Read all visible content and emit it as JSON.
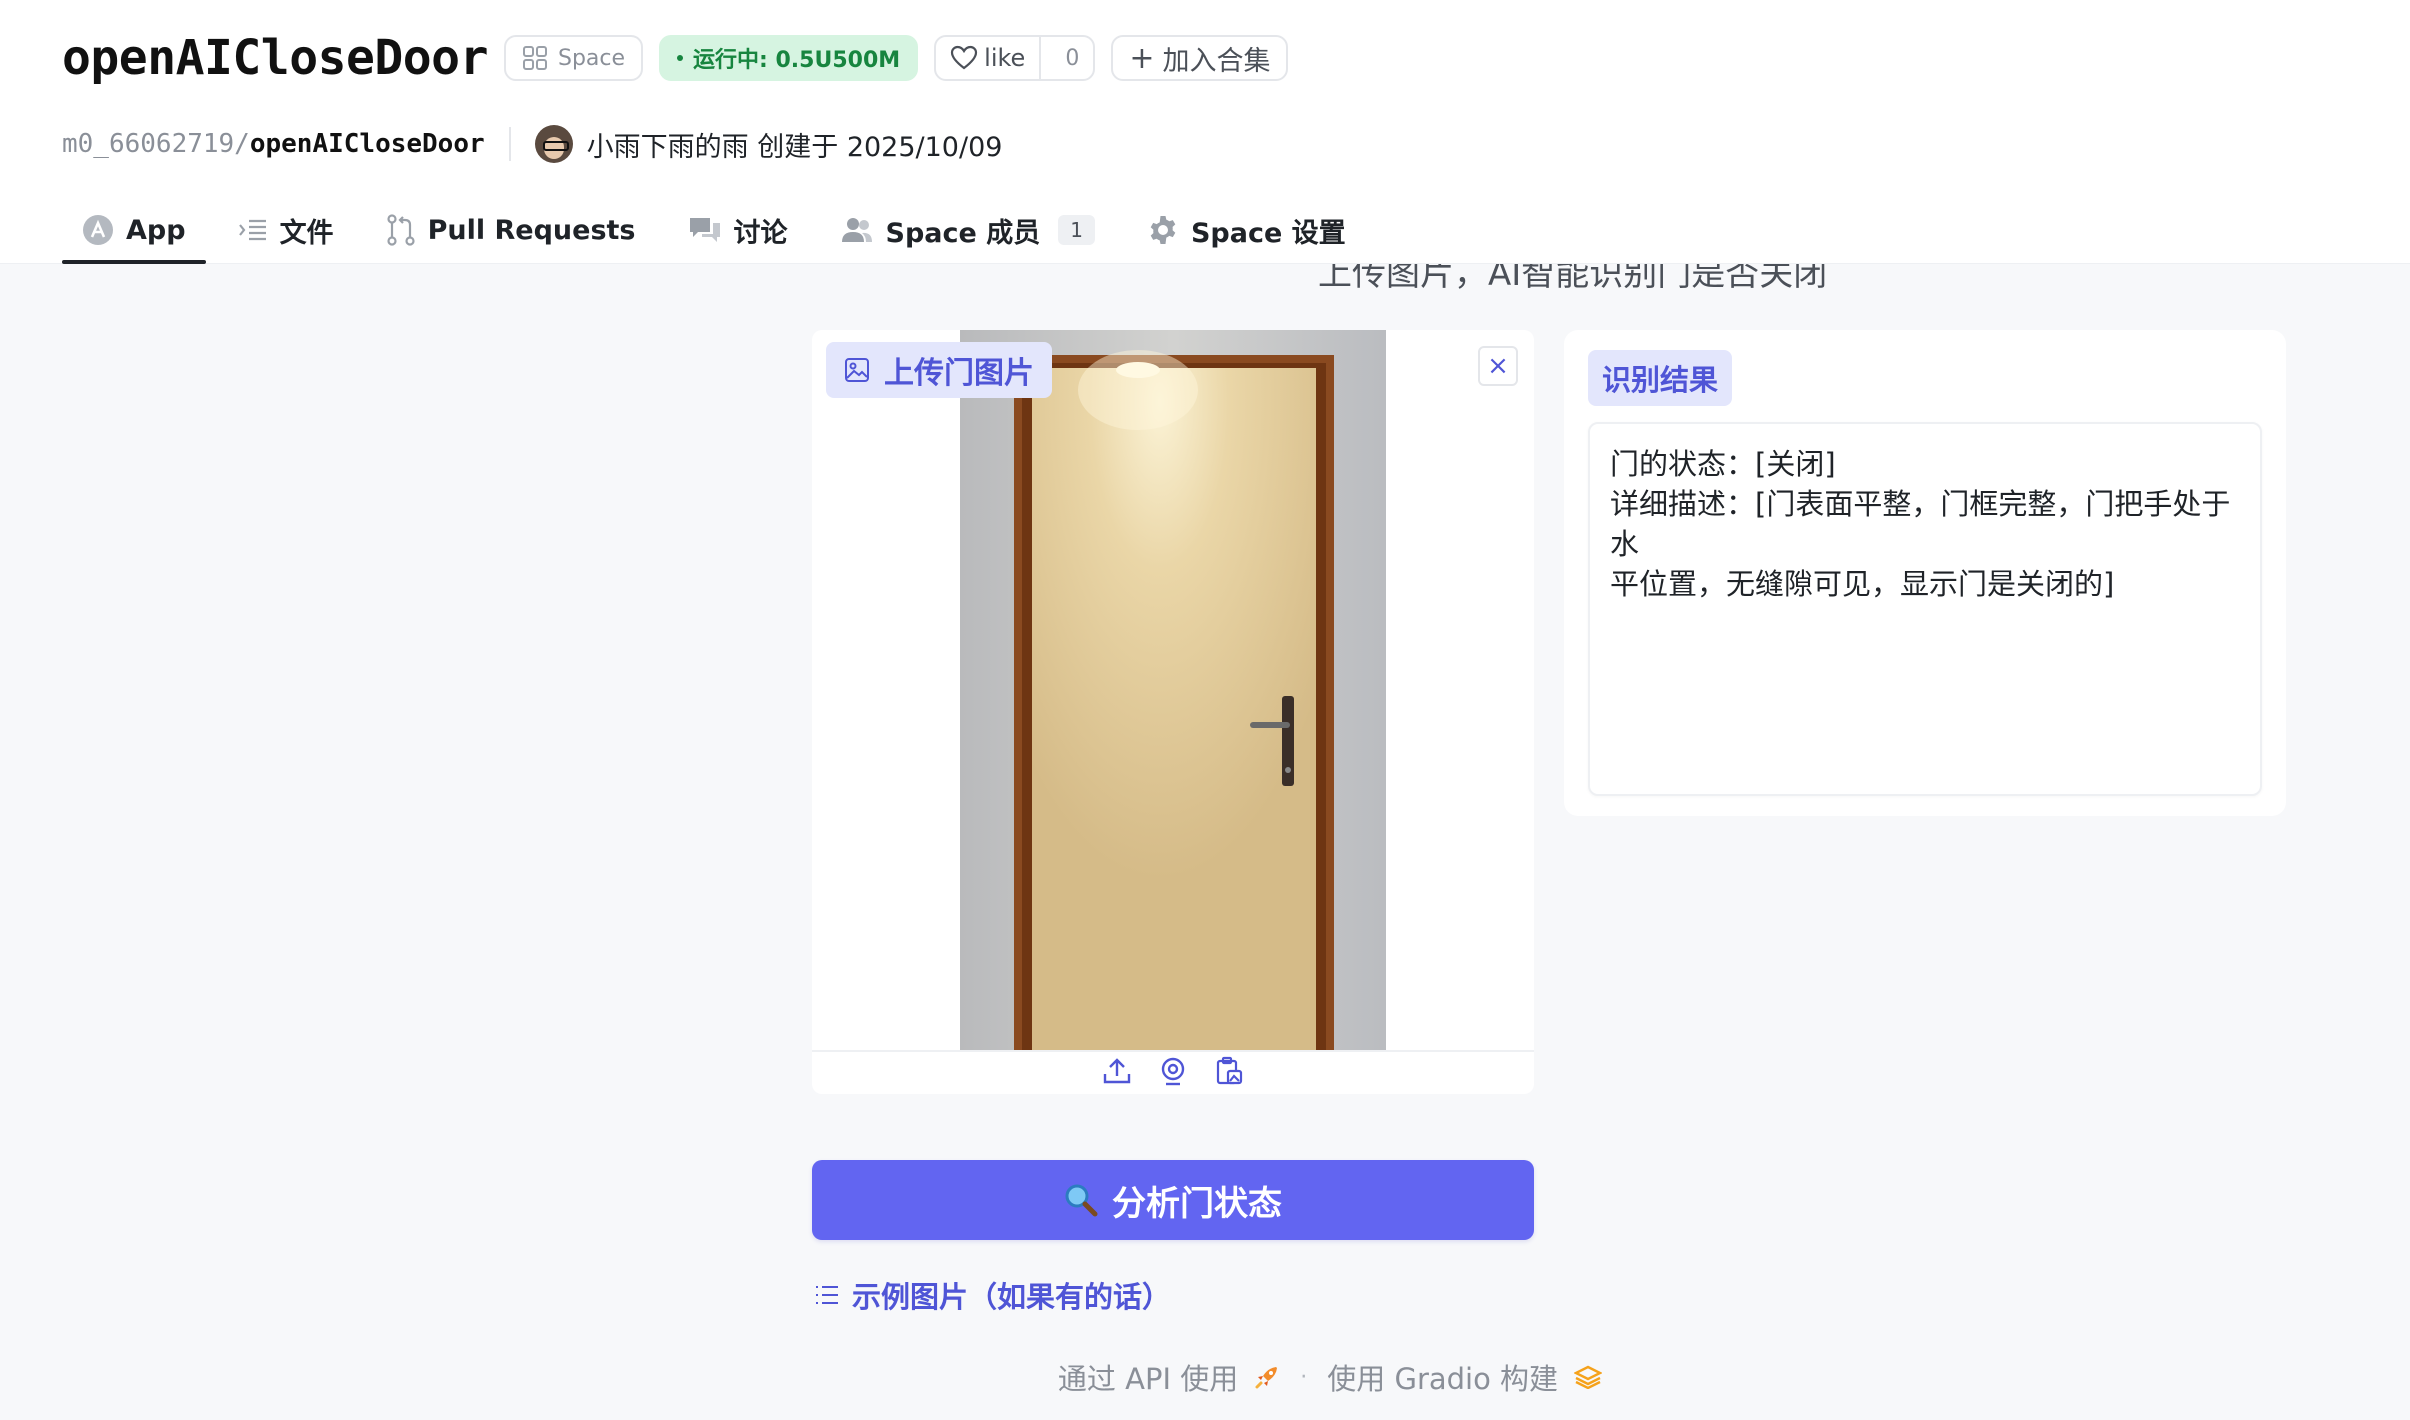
{
  "header": {
    "space_title": "openAICloseDoor",
    "space_pill": "Space",
    "status_pill": "运行中: 0.5U500M",
    "like_label": "like",
    "like_count": "0",
    "collect_label": "加入合集",
    "owner": "m0_66062719/",
    "repo": "openAICloseDoor",
    "author_text": "小雨下雨的雨 创建于 2025/10/09"
  },
  "tabs": [
    {
      "label": "App",
      "icon": "app-icon"
    },
    {
      "label": "文件",
      "icon": "files-icon"
    },
    {
      "label": "Pull Requests",
      "icon": "pull-request-icon"
    },
    {
      "label": "讨论",
      "icon": "discussion-icon"
    },
    {
      "label": "Space 成员",
      "icon": "members-icon",
      "badge": "1"
    },
    {
      "label": "Space 设置",
      "icon": "gear-icon"
    }
  ],
  "app": {
    "subtitle": "上传图片，AI智能识别门是否关闭",
    "image_label": "上传门图片",
    "analyze_button": "分析门状态",
    "examples_label": "示例图片（如果有的话）",
    "result_label": "识别结果",
    "result_lines": [
      "门的状态：[关闭]",
      "详细描述：[门表面平整，门框完整，门把手处于水",
      "平位置，无缝隙可见，显示门是关闭的]"
    ]
  },
  "footer": {
    "api_link": "通过 API 使用",
    "gradio_link": "使用 Gradio 构建"
  },
  "colors": {
    "accent": "#6265f1",
    "accent_text": "#4f55d6",
    "running_bg": "#d6f4e1",
    "running_text": "#17853f"
  }
}
